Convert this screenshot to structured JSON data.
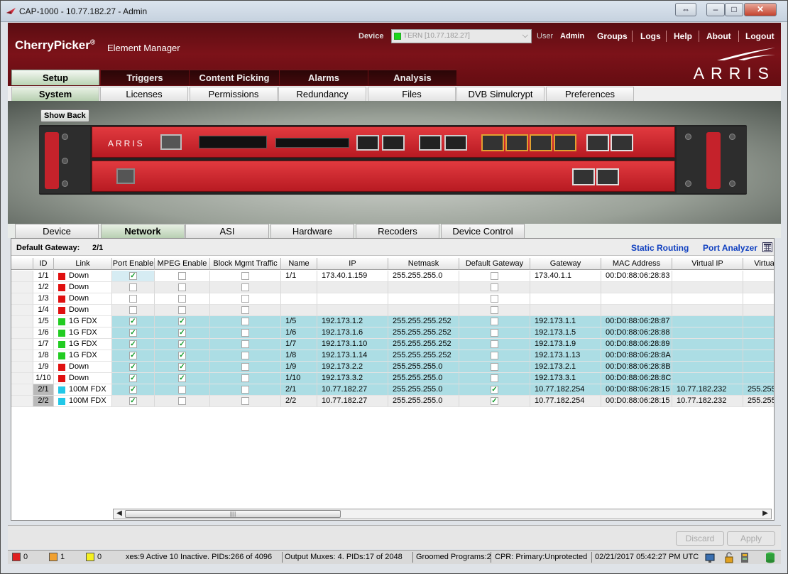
{
  "window": {
    "title": "CAP-1000 - 10.77.182.27 - Admin"
  },
  "header": {
    "brand": "CherryPicker",
    "brand_mark": "®",
    "brand_sub": "Element Manager",
    "device_label": "Device",
    "device_value": "TERN [10.77.182.27]",
    "user_label": "User",
    "user_name": "Admin",
    "links": [
      "Groups",
      "Logs",
      "Help",
      "About",
      "Logout"
    ],
    "logo": "ARRIS"
  },
  "main_tabs": [
    "Setup",
    "Triggers",
    "Content Picking",
    "Alarms",
    "Analysis"
  ],
  "main_tab_active": "Setup",
  "sub_tabs": [
    "System",
    "Licenses",
    "Permissions",
    "Redundancy",
    "Files",
    "DVB Simulcrypt",
    "Preferences"
  ],
  "sub_tab_active": "System",
  "device_view": {
    "show_back_label": "Show Back",
    "faceplate_logo": "ARRIS"
  },
  "device_tabs": [
    "Device",
    "Network",
    "ASI",
    "Hardware",
    "Recoders",
    "Device Control"
  ],
  "device_tab_active": "Network",
  "network": {
    "gateway_label": "Default Gateway:",
    "gateway_value": "2/1",
    "links": [
      "Static Routing",
      "Port Analyzer"
    ],
    "columns": [
      "ID",
      "Link",
      "Port Enable",
      "MPEG Enable",
      "Block Mgmt Traffic",
      "Name",
      "IP",
      "Netmask",
      "Default Gateway",
      "Gateway",
      "MAC Address",
      "Virtual IP",
      "Virtua"
    ],
    "rows": [
      {
        "id": "1/1",
        "link_color": "#e01010",
        "link": "Down",
        "port_enable": true,
        "mpeg_enable": false,
        "block_mgmt": false,
        "name": "1/1",
        "ip": "173.40.1.159",
        "netmask": "255.255.255.0",
        "default_gateway": false,
        "gateway": "173.40.1.1",
        "mac": "00:D0:88:06:28:83",
        "virtual_ip": "",
        "virtua": "",
        "style": "white"
      },
      {
        "id": "1/2",
        "link_color": "#e01010",
        "link": "Down",
        "port_enable": false,
        "mpeg_enable": false,
        "block_mgmt": false,
        "name": "",
        "ip": "",
        "netmask": "",
        "default_gateway": false,
        "gateway": "",
        "mac": "",
        "virtual_ip": "",
        "virtua": "",
        "style": "grey"
      },
      {
        "id": "1/3",
        "link_color": "#e01010",
        "link": "Down",
        "port_enable": false,
        "mpeg_enable": false,
        "block_mgmt": false,
        "name": "",
        "ip": "",
        "netmask": "",
        "default_gateway": false,
        "gateway": "",
        "mac": "",
        "virtual_ip": "",
        "virtua": "",
        "style": "white"
      },
      {
        "id": "1/4",
        "link_color": "#e01010",
        "link": "Down",
        "port_enable": false,
        "mpeg_enable": false,
        "block_mgmt": false,
        "name": "",
        "ip": "",
        "netmask": "",
        "default_gateway": false,
        "gateway": "",
        "mac": "",
        "virtual_ip": "",
        "virtua": "",
        "style": "grey"
      },
      {
        "id": "1/5",
        "link_color": "#22cc22",
        "link": "1G FDX",
        "port_enable": true,
        "mpeg_enable": true,
        "block_mgmt": false,
        "name": "1/5",
        "ip": "192.173.1.2",
        "netmask": "255.255.255.252",
        "default_gateway": false,
        "gateway": "192.173.1.1",
        "mac": "00:D0:88:06:28:87",
        "virtual_ip": "",
        "virtua": "",
        "style": "teal"
      },
      {
        "id": "1/6",
        "link_color": "#22cc22",
        "link": "1G FDX",
        "port_enable": true,
        "mpeg_enable": true,
        "block_mgmt": false,
        "name": "1/6",
        "ip": "192.173.1.6",
        "netmask": "255.255.255.252",
        "default_gateway": false,
        "gateway": "192.173.1.5",
        "mac": "00:D0:88:06:28:88",
        "virtual_ip": "",
        "virtua": "",
        "style": "teal"
      },
      {
        "id": "1/7",
        "link_color": "#22cc22",
        "link": "1G FDX",
        "port_enable": true,
        "mpeg_enable": true,
        "block_mgmt": false,
        "name": "1/7",
        "ip": "192.173.1.10",
        "netmask": "255.255.255.252",
        "default_gateway": false,
        "gateway": "192.173.1.9",
        "mac": "00:D0:88:06:28:89",
        "virtual_ip": "",
        "virtua": "",
        "style": "teal"
      },
      {
        "id": "1/8",
        "link_color": "#22cc22",
        "link": "1G FDX",
        "port_enable": true,
        "mpeg_enable": true,
        "block_mgmt": false,
        "name": "1/8",
        "ip": "192.173.1.14",
        "netmask": "255.255.255.252",
        "default_gateway": false,
        "gateway": "192.173.1.13",
        "mac": "00:D0:88:06:28:8A",
        "virtual_ip": "",
        "virtua": "",
        "style": "teal"
      },
      {
        "id": "1/9",
        "link_color": "#e01010",
        "link": "Down",
        "port_enable": true,
        "mpeg_enable": true,
        "block_mgmt": false,
        "name": "1/9",
        "ip": "192.173.2.2",
        "netmask": "255.255.255.0",
        "default_gateway": false,
        "gateway": "192.173.2.1",
        "mac": "00:D0:88:06:28:8B",
        "virtual_ip": "",
        "virtua": "",
        "style": "teal"
      },
      {
        "id": "1/10",
        "link_color": "#e01010",
        "link": "Down",
        "port_enable": true,
        "mpeg_enable": true,
        "block_mgmt": false,
        "name": "1/10",
        "ip": "192.173.3.2",
        "netmask": "255.255.255.0",
        "default_gateway": false,
        "gateway": "192.173.3.1",
        "mac": "00:D0:88:06:28:8C",
        "virtual_ip": "",
        "virtua": "",
        "style": "teal"
      },
      {
        "id": "2/1",
        "link_color": "#22c8e8",
        "link": "100M FDX",
        "port_enable": true,
        "mpeg_enable": false,
        "block_mgmt": false,
        "name": "2/1",
        "ip": "10.77.182.27",
        "netmask": "255.255.255.0",
        "default_gateway": true,
        "gateway": "10.77.182.254",
        "mac": "00:D0:88:06:28:15",
        "virtual_ip": "10.77.182.232",
        "virtua": "255.255",
        "style": "teal"
      },
      {
        "id": "2/2",
        "link_color": "#22c8e8",
        "link": "100M FDX",
        "port_enable": true,
        "mpeg_enable": false,
        "block_mgmt": false,
        "name": "2/2",
        "ip": "10.77.182.27",
        "netmask": "255.255.255.0",
        "default_gateway": true,
        "gateway": "10.77.182.254",
        "mac": "00:D0:88:06:28:15",
        "virtual_ip": "10.77.182.232",
        "virtua": "255.255",
        "style": "grey"
      }
    ]
  },
  "buttons": {
    "discard": "Discard",
    "apply": "Apply"
  },
  "status": {
    "alarm_counts": [
      {
        "color": "#e02020",
        "count": "0"
      },
      {
        "color": "#f0a030",
        "count": "1"
      },
      {
        "color": "#f5f020",
        "count": "0"
      }
    ],
    "items": [
      "xes:9 Active 10 Inactive.  PIDs:266 of 4096",
      "Output Muxes: 4.  PIDs:17 of 2048",
      "Groomed Programs:2",
      "CPR: Primary:Unprotected",
      "02/21/2017 05:42:27 PM UTC"
    ]
  }
}
